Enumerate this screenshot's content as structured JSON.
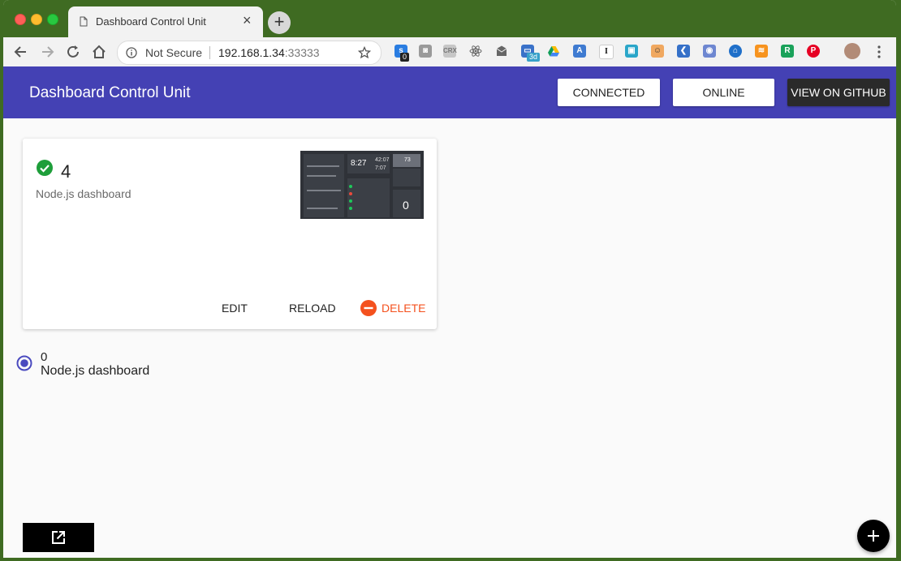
{
  "browser": {
    "tab_title": "Dashboard Control Unit",
    "security_label": "Not Secure",
    "url_host": "192.168.1.34",
    "url_port": ":33333",
    "extension_badges": {
      "counter": "0",
      "threed": "3d"
    },
    "extension_labels": {
      "crx": "CRX",
      "instapaper": "I",
      "r": "R",
      "pinterest": "P"
    }
  },
  "header": {
    "title": "Dashboard Control Unit",
    "connected_label": "CONNECTED",
    "online_label": "ONLINE",
    "github_label": "VIEW ON GITHUB",
    "color": "#4441b4"
  },
  "card": {
    "count": "4",
    "subtitle": "Node.js dashboard",
    "status_icon": "check-circle-icon",
    "thumbnail": {
      "big_number": "0",
      "time_main": "8:27",
      "time_small": "42:07",
      "temp": "73",
      "time_tertiary": "7:07"
    },
    "actions": {
      "edit": "EDIT",
      "reload": "RELOAD",
      "delete": "DELETE"
    },
    "delete_color": "#f4511e"
  },
  "list": {
    "selected_count": "0",
    "selected_label": "Node.js dashboard"
  }
}
